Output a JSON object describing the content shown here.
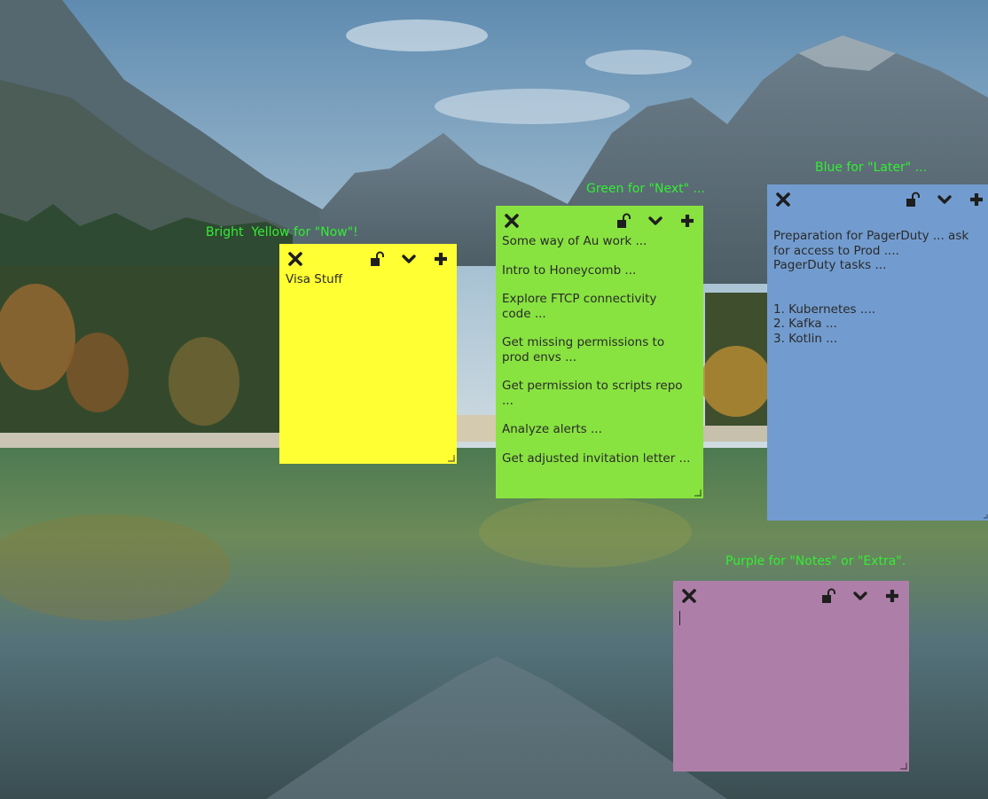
{
  "labels": {
    "yellow": "Bright  Yellow for \"Now\"!",
    "green": "Green for \"Next\" ...",
    "blue": "Blue for \"Later\" ...",
    "purple": "Purple for \"Notes\" or \"Extra\"."
  },
  "colors": {
    "label_text": "#33ee33",
    "yellow_note": "#ffff33",
    "green_note": "#88e340",
    "blue_note": "#729ccf",
    "purple_note": "#ad7fa8"
  },
  "icons": [
    "close-icon",
    "lock-icon",
    "chevron-down-icon",
    "plus-icon",
    "resize-grip-icon"
  ],
  "notes": {
    "yellow": {
      "lines": [
        "Visa Stuff"
      ]
    },
    "green": {
      "lines": [
        "Some way of Au work ...",
        "Intro to Honeycomb ...",
        "Explore FTCP connectivity code ...",
        "Get missing permissions to prod envs ...",
        "Get permission to scripts repo ...",
        "Analyze alerts ...",
        "Get adjusted invitation letter ..."
      ]
    },
    "blue": {
      "lines": [
        "Preparation for PagerDuty ... ask for access to Prod ....",
        "PagerDuty tasks ...",
        "",
        "",
        "1. Kubernetes ....",
        "2. Kafka ...",
        "3. Kotlin ..."
      ]
    },
    "purple": {
      "lines": []
    }
  }
}
